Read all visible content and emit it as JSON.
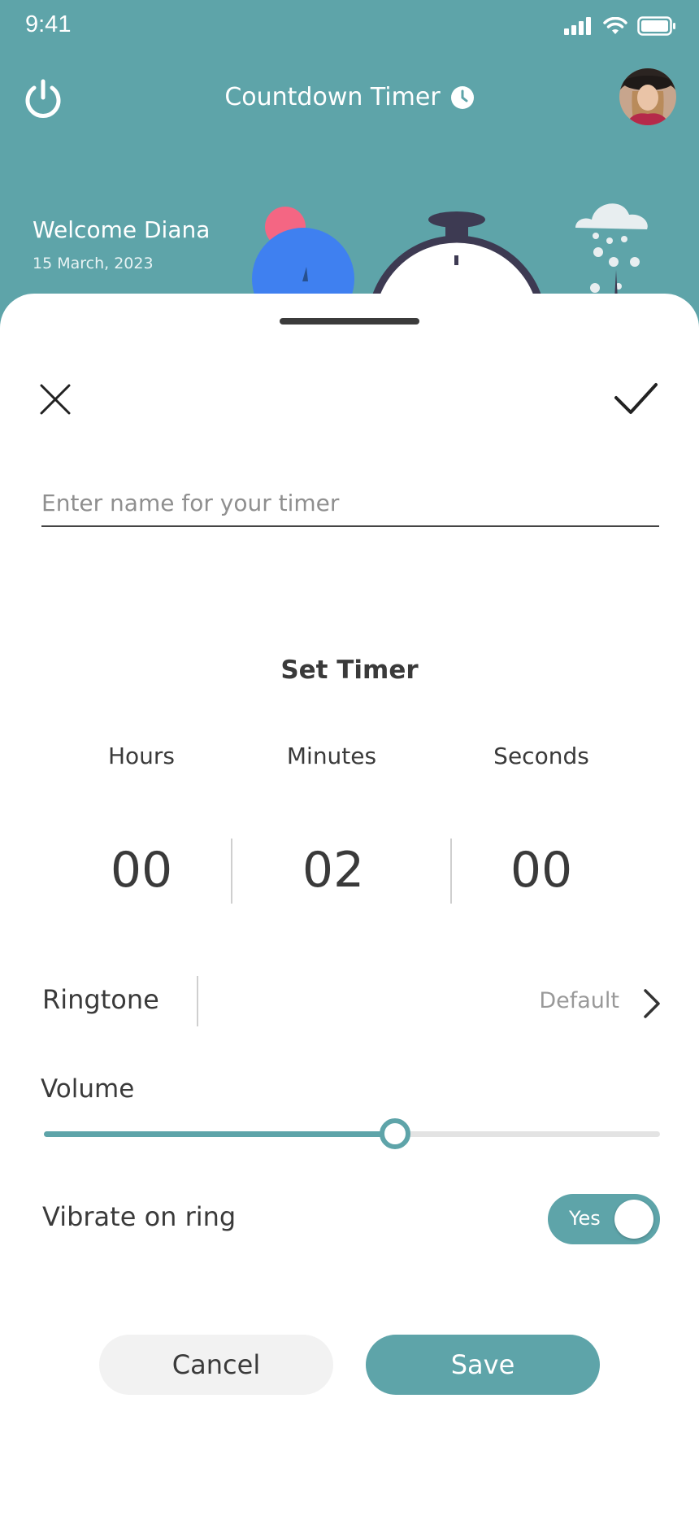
{
  "status_bar": {
    "time": "9:41"
  },
  "header": {
    "title": "Countdown Timer",
    "power_icon": "power-icon",
    "clock_icon": "clock-icon"
  },
  "greeting": {
    "welcome": "Welcome Diana",
    "date": "15 March, 2023"
  },
  "form": {
    "name_placeholder": "Enter name for your timer",
    "name_value": "",
    "set_timer_label": "Set Timer",
    "columns": [
      {
        "label": "Hours",
        "value": "00"
      },
      {
        "label": "Minutes",
        "value": "02"
      },
      {
        "label": "Seconds",
        "value": "00"
      }
    ],
    "ringtone": {
      "label": "Ringtone",
      "value": "Default"
    },
    "volume": {
      "label": "Volume",
      "level": 0.57
    },
    "vibrate": {
      "label": "Vibrate on ring",
      "toggle_text": "Yes",
      "on": true
    }
  },
  "actions": {
    "cancel": "Cancel",
    "save": "Save"
  },
  "colors": {
    "accent": "#5ea4a9",
    "text": "#3a3a3a",
    "muted": "#999999",
    "illustration_blue": "#3f80f0",
    "illustration_pink": "#f46683",
    "illustration_dark": "#3d3a52"
  }
}
